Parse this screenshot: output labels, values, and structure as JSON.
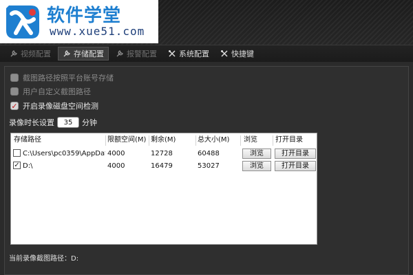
{
  "logo": {
    "title": "软件学堂",
    "url": "www.xue51.com"
  },
  "tabs": [
    {
      "label": "视频配置",
      "icon": "wrench-icon",
      "state": "dim"
    },
    {
      "label": "存储配置",
      "icon": "wrench-icon",
      "state": "active"
    },
    {
      "label": "报警配置",
      "icon": "wrench-icon",
      "state": "dim"
    },
    {
      "label": "系统配置",
      "icon": "tools-icon",
      "state": "normal"
    },
    {
      "label": "快捷键",
      "icon": "tools-icon",
      "state": "normal"
    }
  ],
  "options": [
    {
      "label": "截图路径按照平台账号存储",
      "checked": false,
      "enabled": false
    },
    {
      "label": "用户自定义截图路径",
      "checked": false,
      "enabled": false
    },
    {
      "label": "开启录像磁盘空间检测",
      "checked": true,
      "enabled": true
    }
  ],
  "duration": {
    "label": "录像时长设置",
    "value": "35",
    "unit": "分钟"
  },
  "table": {
    "headers": [
      "存储路径",
      "限额空间(M)",
      "剩余(M)",
      "总大小(M)",
      "浏览",
      "打开目录"
    ],
    "rows": [
      {
        "checked": false,
        "path": "C:\\Users\\pc0359\\AppData\\...",
        "quota": "4000",
        "free": "12728",
        "total": "60488",
        "browse": "浏览",
        "open": "打开目录"
      },
      {
        "checked": true,
        "path": "D:\\",
        "quota": "4000",
        "free": "16479",
        "total": "53027",
        "browse": "浏览",
        "open": "打开目录"
      }
    ]
  },
  "footer": {
    "current_path_label": "当前录像截图路径：D:"
  },
  "colors": {
    "accent_red": "#c0151a",
    "logo_blue": "#1e7fd0",
    "background": "#2b2b2b"
  }
}
